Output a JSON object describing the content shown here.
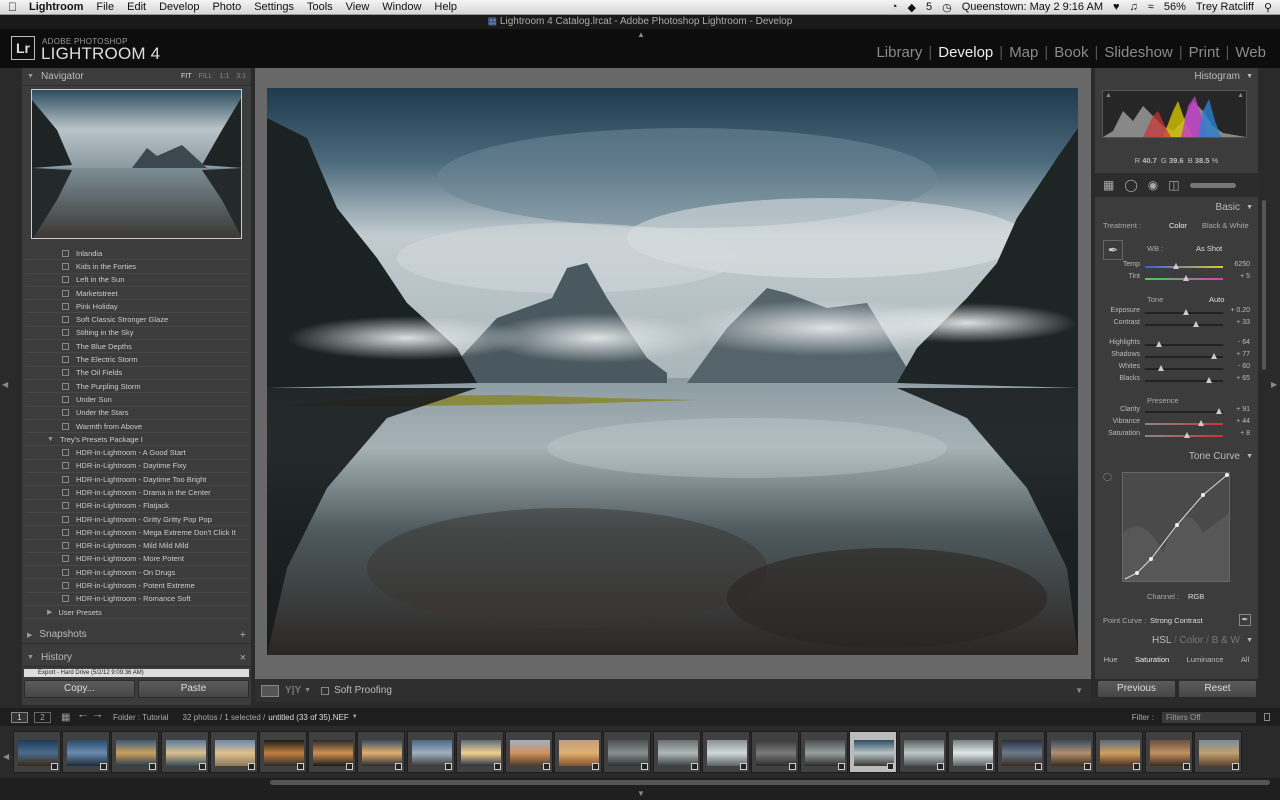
{
  "menubar": {
    "apple": "",
    "app_name": "Lightroom",
    "items": [
      "File",
      "Edit",
      "Develop",
      "Photo",
      "Settings",
      "Tools",
      "View",
      "Window",
      "Help"
    ],
    "status_five": "5",
    "location_time": "Queenstown: May 2  9:16 AM",
    "battery": "56%",
    "user": "Trey Ratcliff"
  },
  "window_title": "Lightroom 4 Catalog.lrcat - Adobe Photoshop Lightroom - Develop",
  "identity": {
    "logo": "Lr",
    "small": "ADOBE PHOTOSHOP",
    "big": "LIGHTROOM 4"
  },
  "modules": [
    "Library",
    "Develop",
    "Map",
    "Book",
    "Slideshow",
    "Print",
    "Web"
  ],
  "active_module": "Develop",
  "left": {
    "navigator": {
      "title": "Navigator",
      "options": [
        "FIT",
        "FILL",
        "1:1",
        "3:1"
      ]
    },
    "presets": [
      {
        "label": "Inlandia",
        "folder": false
      },
      {
        "label": "Kids in the Forties",
        "folder": false
      },
      {
        "label": "Left in the Sun",
        "folder": false
      },
      {
        "label": "Marketstreet",
        "folder": false
      },
      {
        "label": "Pink Holiday",
        "folder": false
      },
      {
        "label": "Soft Classic Stronger Glaze",
        "folder": false
      },
      {
        "label": "Stilting in the Sky",
        "folder": false
      },
      {
        "label": "The Blue Depths",
        "folder": false
      },
      {
        "label": "The Electric Storm",
        "folder": false
      },
      {
        "label": "The Oil Fields",
        "folder": false
      },
      {
        "label": "The Purpling Storm",
        "folder": false
      },
      {
        "label": "Under Sun",
        "folder": false
      },
      {
        "label": "Under the Stars",
        "folder": false
      },
      {
        "label": "Warmth from Above",
        "folder": false
      },
      {
        "label": "Trey's Presets Package I",
        "folder": true
      },
      {
        "label": "HDR-in-Lightroom - A Good Start",
        "folder": false
      },
      {
        "label": "HDR-in-Lightroom - Daytime Fixy",
        "folder": false
      },
      {
        "label": "HDR-in-Lightroom - Daytime Too Bright",
        "folder": false
      },
      {
        "label": "HDR-in-Lightroom - Drama in the Center",
        "folder": false
      },
      {
        "label": "HDR-in-Lightroom - Flatjack",
        "folder": false
      },
      {
        "label": "HDR-in-Lightroom - Gritty Gritty Pop Pop",
        "folder": false
      },
      {
        "label": "HDR-in-Lightroom - Mega Extreme Don't Click It",
        "folder": false
      },
      {
        "label": "HDR-in-Lightroom - Mild Mild Mild",
        "folder": false
      },
      {
        "label": "HDR-in-Lightroom - More Potent",
        "folder": false
      },
      {
        "label": "HDR-in-Lightroom - On Drugs",
        "folder": false
      },
      {
        "label": "HDR-in-Lightroom - Potent Extreme",
        "folder": false
      },
      {
        "label": "HDR-in-Lightroom - Romance Soft",
        "folder": false
      },
      {
        "label": "User Presets",
        "folder": true
      }
    ],
    "snapshots": "Snapshots",
    "history": "History",
    "history_entry": "Export - Hard Drive (5/2/12 9:09:36 AM)",
    "copy_label": "Copy...",
    "paste_label": "Paste"
  },
  "toolbar": {
    "soft_proofing": "Soft Proofing"
  },
  "right": {
    "histogram_title": "Histogram",
    "rgb": {
      "r_label": "R",
      "r": "40.7",
      "g_label": "G",
      "g": "39.6",
      "b_label": "B",
      "b": "38.5",
      "unit": "%"
    },
    "basic_title": "Basic",
    "treatment_label": "Treatment :",
    "treatment_color": "Color",
    "treatment_bw": "Black & White",
    "wb_label": "WB :",
    "wb_value": "As Shot",
    "tone_label": "Tone",
    "auto_label": "Auto",
    "presence_label": "Presence",
    "sliders": [
      {
        "label": "Temp",
        "value": "6250",
        "pos": 0.4
      },
      {
        "label": "Tint",
        "value": "+ 5",
        "pos": 0.52
      },
      {
        "label": "Exposure",
        "value": "+ 0.20",
        "pos": 0.52
      },
      {
        "label": "Contrast",
        "value": "+ 33",
        "pos": 0.66
      },
      {
        "label": "Highlights",
        "value": "- 64",
        "pos": 0.18
      },
      {
        "label": "Shadows",
        "value": "+ 77",
        "pos": 0.88
      },
      {
        "label": "Whites",
        "value": "- 60",
        "pos": 0.2
      },
      {
        "label": "Blacks",
        "value": "+ 65",
        "pos": 0.82
      },
      {
        "label": "Clarity",
        "value": "+ 91",
        "pos": 0.95
      },
      {
        "label": "Vibrance",
        "value": "+ 44",
        "pos": 0.72
      },
      {
        "label": "Saturation",
        "value": "+ 8",
        "pos": 0.54
      }
    ],
    "tone_curve_title": "Tone Curve",
    "channel_label": "Channel :",
    "channel_value": "RGB",
    "point_curve_label": "Point Curve :",
    "point_curve_value": "Strong Contrast",
    "hsl_title": "HSL",
    "color_title": "Color",
    "bw_title": "B & W",
    "hsl_tabs": [
      "Hue",
      "Saturation",
      "Luminance",
      "All"
    ],
    "previous_label": "Previous",
    "reset_label": "Reset"
  },
  "filmbar": {
    "page1": "1",
    "page2": "2",
    "folder": "Folder : Tutorial",
    "count": "32 photos / 1 selected /",
    "file": "untitled (33 of 35).NEF",
    "filter_label": "Filter :",
    "filter_value": "Filters Off"
  },
  "filmstrip_count": 25,
  "selected_thumb": 17
}
